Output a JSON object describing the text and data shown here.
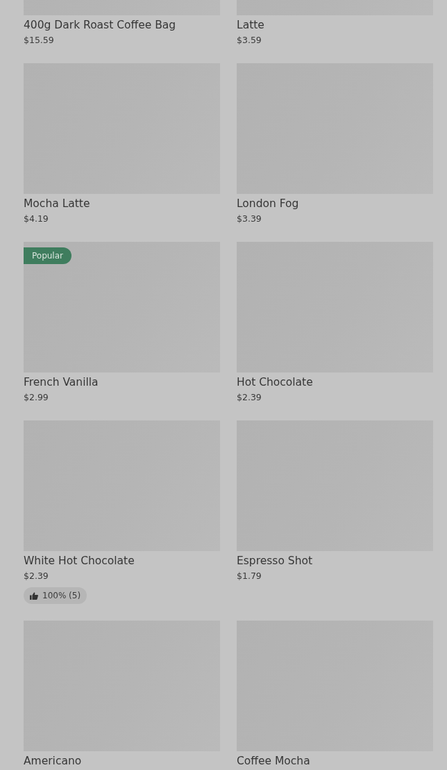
{
  "products": [
    {
      "name": "400g Dark Roast Coffee Bag",
      "price": "$15.59"
    },
    {
      "name": "Latte",
      "price": "$3.59"
    },
    {
      "name": "Mocha Latte",
      "price": "$4.19"
    },
    {
      "name": "London Fog",
      "price": "$3.39"
    },
    {
      "name": "French Vanilla",
      "price": "$2.99",
      "badge": "Popular"
    },
    {
      "name": "Hot Chocolate",
      "price": "$2.39"
    },
    {
      "name": "White Hot Chocolate",
      "price": "$2.39",
      "rating": "100% (5)"
    },
    {
      "name": "Espresso Shot",
      "price": "$1.79"
    },
    {
      "name": "Americano"
    },
    {
      "name": "Coffee Mocha"
    }
  ]
}
